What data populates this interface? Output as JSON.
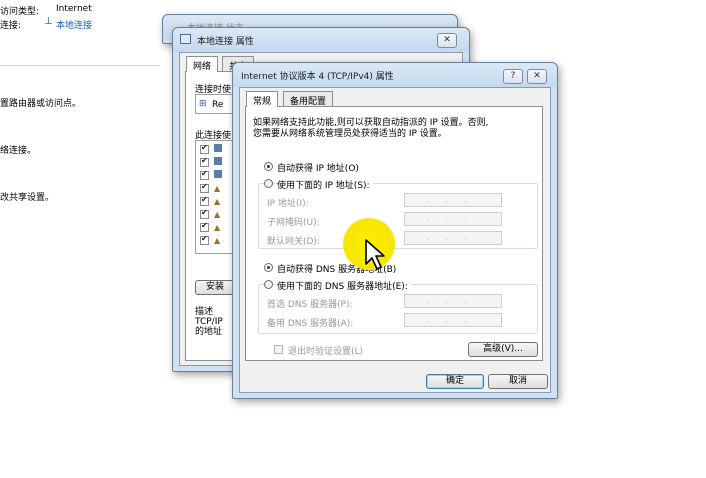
{
  "background": {
    "access_type_label": "访问类型:",
    "access_type_value": "Internet",
    "connection_label": "连接:",
    "connection_value": "本地连接",
    "line1": "置路由器或访问点。",
    "line2": "络连接。",
    "line3": "改共享设置。"
  },
  "win_back": {
    "title": "本地连接 状态"
  },
  "win_props": {
    "title": "本地连接 属性",
    "close": "✕",
    "tabs": [
      "网络",
      "共享"
    ],
    "connect_using_label": "连接时使",
    "adapter_text": "Re",
    "items_label": "此连接使",
    "install_button": "安装",
    "description_label": "描述",
    "description_text": "TCP/IP\n的地址"
  },
  "win_ipv4": {
    "title": "Internet 协议版本 4 (TCP/IPv4) 属性",
    "help": "?",
    "close": "✕",
    "tabs": [
      "常规",
      "备用配置"
    ],
    "intro_line1": "如果网络支持此功能,则可以获取自动指派的 IP 设置。否则,",
    "intro_line2": "您需要从网络系统管理员处获得适当的 IP 设置。",
    "auto_ip": "自动获得 IP 地址(O)",
    "manual_ip": "使用下面的 IP 地址(S):",
    "ip_address": "IP 地址(I):",
    "subnet_mask": "子网掩码(U):",
    "default_gateway": "默认网关(D):",
    "auto_dns": "自动获得 DNS 服务器地址(B)",
    "manual_dns": "使用下面的 DNS 服务器地址(E):",
    "preferred_dns": "首选 DNS 服务器(P):",
    "alternate_dns": "备用 DNS 服务器(A):",
    "validate_on_exit": "退出时验证设置(L)",
    "advanced_button": "高级(V)...",
    "ok_button": "确定",
    "cancel_button": "取消",
    "ip_placeholder": "..."
  },
  "colors": {
    "highlight": "#f7e600",
    "link": "#1a5fb4",
    "title_bar": "#c4d8ee"
  }
}
